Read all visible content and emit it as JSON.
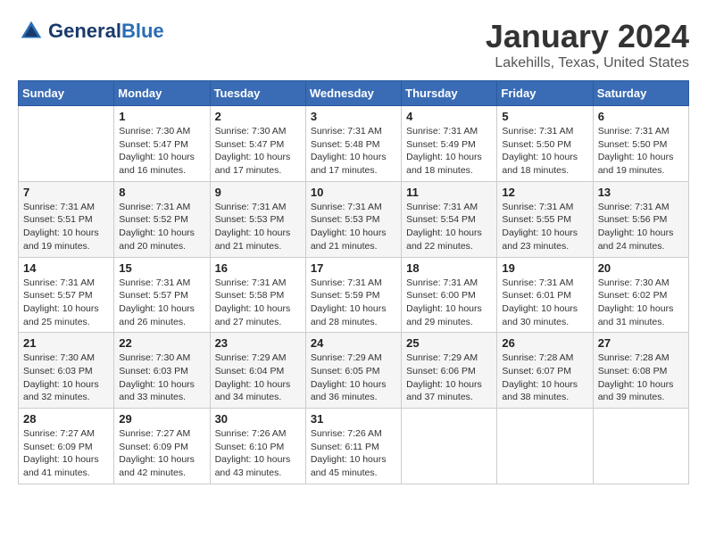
{
  "header": {
    "logo_general": "General",
    "logo_blue": "Blue",
    "title": "January 2024",
    "subtitle": "Lakehills, Texas, United States"
  },
  "weekdays": [
    "Sunday",
    "Monday",
    "Tuesday",
    "Wednesday",
    "Thursday",
    "Friday",
    "Saturday"
  ],
  "weeks": [
    [
      {
        "day": "",
        "info": ""
      },
      {
        "day": "1",
        "info": "Sunrise: 7:30 AM\nSunset: 5:47 PM\nDaylight: 10 hours\nand 16 minutes."
      },
      {
        "day": "2",
        "info": "Sunrise: 7:30 AM\nSunset: 5:47 PM\nDaylight: 10 hours\nand 17 minutes."
      },
      {
        "day": "3",
        "info": "Sunrise: 7:31 AM\nSunset: 5:48 PM\nDaylight: 10 hours\nand 17 minutes."
      },
      {
        "day": "4",
        "info": "Sunrise: 7:31 AM\nSunset: 5:49 PM\nDaylight: 10 hours\nand 18 minutes."
      },
      {
        "day": "5",
        "info": "Sunrise: 7:31 AM\nSunset: 5:50 PM\nDaylight: 10 hours\nand 18 minutes."
      },
      {
        "day": "6",
        "info": "Sunrise: 7:31 AM\nSunset: 5:50 PM\nDaylight: 10 hours\nand 19 minutes."
      }
    ],
    [
      {
        "day": "7",
        "info": "Sunrise: 7:31 AM\nSunset: 5:51 PM\nDaylight: 10 hours\nand 19 minutes."
      },
      {
        "day": "8",
        "info": "Sunrise: 7:31 AM\nSunset: 5:52 PM\nDaylight: 10 hours\nand 20 minutes."
      },
      {
        "day": "9",
        "info": "Sunrise: 7:31 AM\nSunset: 5:53 PM\nDaylight: 10 hours\nand 21 minutes."
      },
      {
        "day": "10",
        "info": "Sunrise: 7:31 AM\nSunset: 5:53 PM\nDaylight: 10 hours\nand 21 minutes."
      },
      {
        "day": "11",
        "info": "Sunrise: 7:31 AM\nSunset: 5:54 PM\nDaylight: 10 hours\nand 22 minutes."
      },
      {
        "day": "12",
        "info": "Sunrise: 7:31 AM\nSunset: 5:55 PM\nDaylight: 10 hours\nand 23 minutes."
      },
      {
        "day": "13",
        "info": "Sunrise: 7:31 AM\nSunset: 5:56 PM\nDaylight: 10 hours\nand 24 minutes."
      }
    ],
    [
      {
        "day": "14",
        "info": "Sunrise: 7:31 AM\nSunset: 5:57 PM\nDaylight: 10 hours\nand 25 minutes."
      },
      {
        "day": "15",
        "info": "Sunrise: 7:31 AM\nSunset: 5:57 PM\nDaylight: 10 hours\nand 26 minutes."
      },
      {
        "day": "16",
        "info": "Sunrise: 7:31 AM\nSunset: 5:58 PM\nDaylight: 10 hours\nand 27 minutes."
      },
      {
        "day": "17",
        "info": "Sunrise: 7:31 AM\nSunset: 5:59 PM\nDaylight: 10 hours\nand 28 minutes."
      },
      {
        "day": "18",
        "info": "Sunrise: 7:31 AM\nSunset: 6:00 PM\nDaylight: 10 hours\nand 29 minutes."
      },
      {
        "day": "19",
        "info": "Sunrise: 7:31 AM\nSunset: 6:01 PM\nDaylight: 10 hours\nand 30 minutes."
      },
      {
        "day": "20",
        "info": "Sunrise: 7:30 AM\nSunset: 6:02 PM\nDaylight: 10 hours\nand 31 minutes."
      }
    ],
    [
      {
        "day": "21",
        "info": "Sunrise: 7:30 AM\nSunset: 6:03 PM\nDaylight: 10 hours\nand 32 minutes."
      },
      {
        "day": "22",
        "info": "Sunrise: 7:30 AM\nSunset: 6:03 PM\nDaylight: 10 hours\nand 33 minutes."
      },
      {
        "day": "23",
        "info": "Sunrise: 7:29 AM\nSunset: 6:04 PM\nDaylight: 10 hours\nand 34 minutes."
      },
      {
        "day": "24",
        "info": "Sunrise: 7:29 AM\nSunset: 6:05 PM\nDaylight: 10 hours\nand 36 minutes."
      },
      {
        "day": "25",
        "info": "Sunrise: 7:29 AM\nSunset: 6:06 PM\nDaylight: 10 hours\nand 37 minutes."
      },
      {
        "day": "26",
        "info": "Sunrise: 7:28 AM\nSunset: 6:07 PM\nDaylight: 10 hours\nand 38 minutes."
      },
      {
        "day": "27",
        "info": "Sunrise: 7:28 AM\nSunset: 6:08 PM\nDaylight: 10 hours\nand 39 minutes."
      }
    ],
    [
      {
        "day": "28",
        "info": "Sunrise: 7:27 AM\nSunset: 6:09 PM\nDaylight: 10 hours\nand 41 minutes."
      },
      {
        "day": "29",
        "info": "Sunrise: 7:27 AM\nSunset: 6:09 PM\nDaylight: 10 hours\nand 42 minutes."
      },
      {
        "day": "30",
        "info": "Sunrise: 7:26 AM\nSunset: 6:10 PM\nDaylight: 10 hours\nand 43 minutes."
      },
      {
        "day": "31",
        "info": "Sunrise: 7:26 AM\nSunset: 6:11 PM\nDaylight: 10 hours\nand 45 minutes."
      },
      {
        "day": "",
        "info": ""
      },
      {
        "day": "",
        "info": ""
      },
      {
        "day": "",
        "info": ""
      }
    ]
  ]
}
